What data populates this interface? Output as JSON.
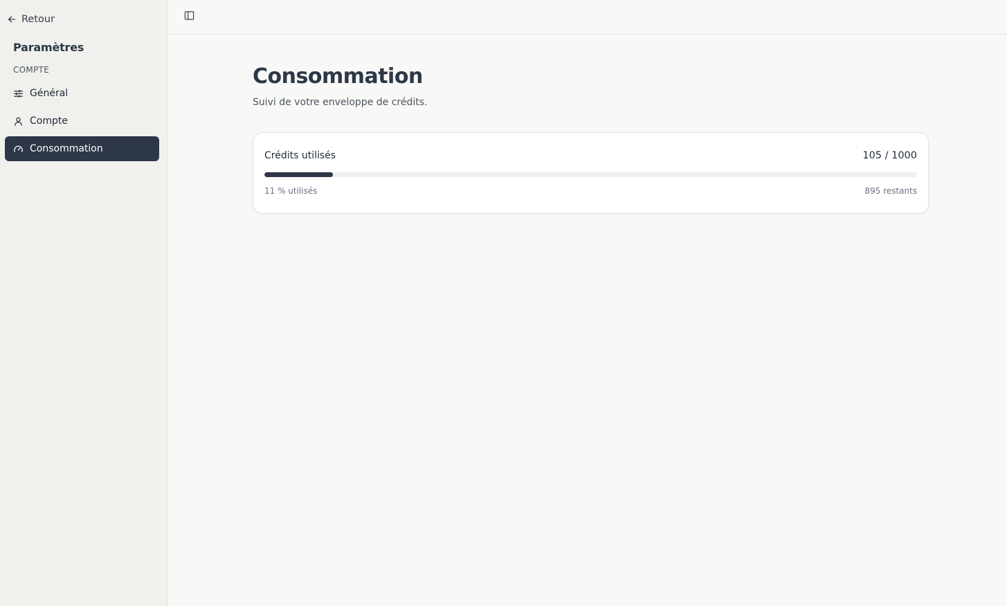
{
  "sidebar": {
    "back_label": "Retour",
    "title": "Paramètres",
    "section_label": "COMPTE",
    "items": [
      {
        "label": "Général",
        "icon": "sliders-icon",
        "active": false
      },
      {
        "label": "Compte",
        "icon": "user-icon",
        "active": false
      },
      {
        "label": "Consommation",
        "icon": "gauge-icon",
        "active": true
      }
    ]
  },
  "topbar": {
    "toggle_icon": "sidebar-toggle-icon"
  },
  "main": {
    "title": "Consommation",
    "subtitle": "Suivi de votre enveloppe de crédits.",
    "credits": {
      "label": "Crédits utilisés",
      "value_text": "105 / 1000",
      "used_fraction": 0.105,
      "percent_text": "11 % utilisés",
      "remaining_text": "895 restants"
    }
  },
  "colors": {
    "accent": "#2d3748",
    "sidebar_bg": "#f0f0ec",
    "page_bg": "#f8f8f6"
  }
}
